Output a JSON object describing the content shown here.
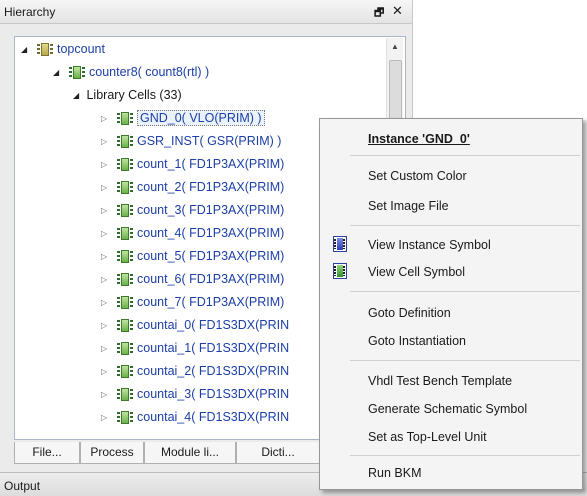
{
  "panel": {
    "title": "Hierarchy",
    "float_icon": "float-icon",
    "close_icon": "close-icon"
  },
  "tree": {
    "items": [
      {
        "label": "topcount",
        "expanded": true,
        "icon": "cell-icon"
      },
      {
        "label": "counter8( count8(rtl) )",
        "expanded": true,
        "icon": "cell-icon"
      },
      {
        "label": "Library Cells (33)",
        "expanded": true,
        "icon": ""
      },
      {
        "label": "GND_0( VLO(PRIM) )",
        "expanded": false,
        "icon": "cell-icon",
        "selected": true
      },
      {
        "label": "GSR_INST( GSR(PRIM) )",
        "expanded": false,
        "icon": "cell-icon"
      },
      {
        "label": "count_1( FD1P3AX(PRIM)",
        "expanded": false,
        "icon": "cell-icon"
      },
      {
        "label": "count_2( FD1P3AX(PRIM)",
        "expanded": false,
        "icon": "cell-icon"
      },
      {
        "label": "count_3( FD1P3AX(PRIM)",
        "expanded": false,
        "icon": "cell-icon"
      },
      {
        "label": "count_4( FD1P3AX(PRIM)",
        "expanded": false,
        "icon": "cell-icon"
      },
      {
        "label": "count_5( FD1P3AX(PRIM)",
        "expanded": false,
        "icon": "cell-icon"
      },
      {
        "label": "count_6( FD1P3AX(PRIM)",
        "expanded": false,
        "icon": "cell-icon"
      },
      {
        "label": "count_7( FD1P3AX(PRIM)",
        "expanded": false,
        "icon": "cell-icon"
      },
      {
        "label": "countai_0( FD1S3DX(PRIN",
        "expanded": false,
        "icon": "cell-icon"
      },
      {
        "label": "countai_1( FD1S3DX(PRIN",
        "expanded": false,
        "icon": "cell-icon"
      },
      {
        "label": "countai_2( FD1S3DX(PRIN",
        "expanded": false,
        "icon": "cell-icon"
      },
      {
        "label": "countai_3( FD1S3DX(PRIN",
        "expanded": false,
        "icon": "cell-icon"
      },
      {
        "label": "countai_4( FD1S3DX(PRIN",
        "expanded": false,
        "icon": "cell-icon"
      }
    ]
  },
  "tabs": [
    "File...",
    "Process",
    "Module li...",
    "Dicti..."
  ],
  "output": {
    "label": "Output"
  },
  "context_menu": {
    "header": "Instance 'GND_0'",
    "items": [
      "Set Custom Color",
      "Set Image File",
      "View Instance Symbol",
      "View Cell Symbol",
      "Goto Definition",
      "Goto Instantiation",
      "Vhdl Test Bench Template",
      "Generate Schematic Symbol",
      "Set as Top-Level Unit",
      "Run BKM"
    ]
  },
  "colors": {
    "link": "#1c3fa8",
    "selection": "#eaf2fb"
  }
}
